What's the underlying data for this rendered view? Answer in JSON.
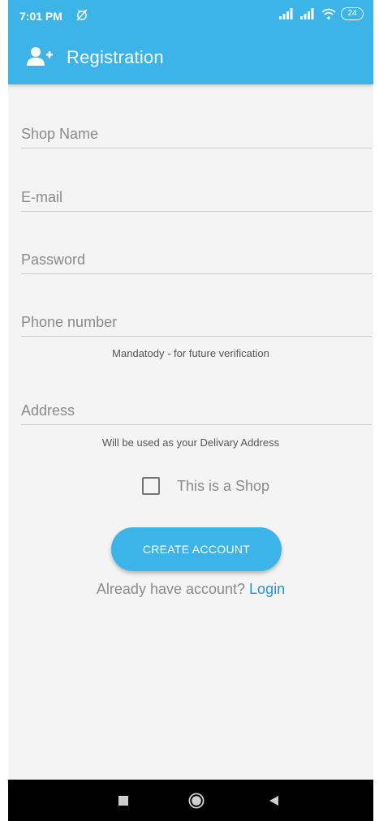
{
  "status_bar": {
    "time": "7:01 PM",
    "battery": "24"
  },
  "app_bar": {
    "title": "Registration",
    "icon": "add-user-icon"
  },
  "form": {
    "shop_name_label": "Shop Name",
    "email_label": "E-mail",
    "password_label": "Password",
    "phone_label": "Phone number",
    "phone_hint": "Mandatody - for future verification",
    "address_label": "Address",
    "address_hint": "Will be used as your Delivary Address",
    "shop_checkbox_label": "This is a Shop",
    "shop_checkbox_checked": false,
    "create_button_label": "CREATE ACCOUNT",
    "login_prompt": "Already have account?",
    "login_link": "Login"
  },
  "colors": {
    "primary": "#3db4e8",
    "link": "#2a8fd6",
    "background": "#f4f4f4"
  }
}
